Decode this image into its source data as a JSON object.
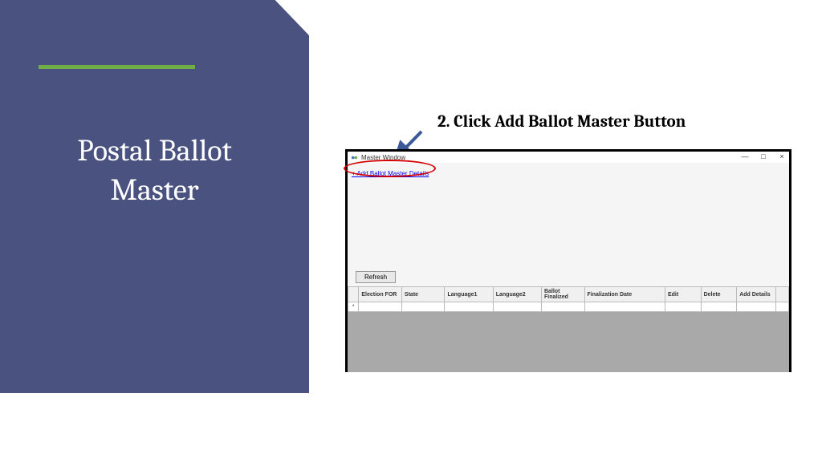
{
  "panel": {
    "title": "Postal Ballot\nMaster"
  },
  "instruction": "2. Click Add Ballot Master Button",
  "window": {
    "title": "Master Window",
    "link": "+ Add Ballot Master Details",
    "refresh": "Refresh",
    "controls": {
      "minimize": "—",
      "maximize": "□",
      "close": "×"
    },
    "columns": {
      "c1": "Election FOR",
      "c2": "State",
      "c3": "Language1",
      "c4": "Language2",
      "c5": "Ballot Finalized",
      "c6": "Finalization Date",
      "c7": "Edit",
      "c8": "Delete",
      "c9": "Add Details"
    },
    "row_marker": "*"
  }
}
